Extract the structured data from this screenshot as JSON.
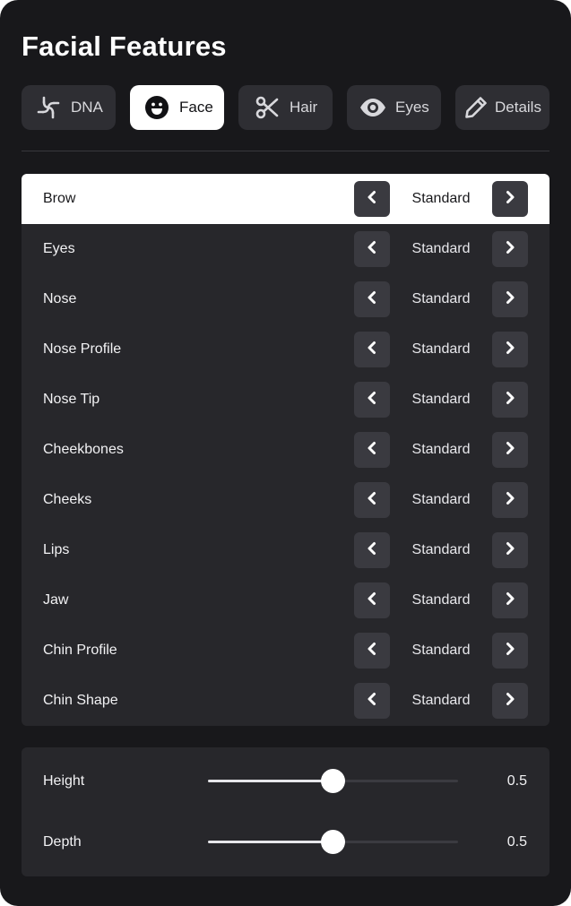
{
  "title": "Facial Features",
  "tabs": [
    {
      "label": "DNA",
      "icon": "dna-icon",
      "active": false
    },
    {
      "label": "Face",
      "icon": "face-smile-icon",
      "active": true
    },
    {
      "label": "Hair",
      "icon": "scissors-icon",
      "active": false
    },
    {
      "label": "Eyes",
      "icon": "eye-icon",
      "active": false
    },
    {
      "label": "Details",
      "icon": "pencil-icon",
      "active": false
    }
  ],
  "features": [
    {
      "label": "Brow",
      "value": "Standard",
      "selected": true
    },
    {
      "label": "Eyes",
      "value": "Standard",
      "selected": false
    },
    {
      "label": "Nose",
      "value": "Standard",
      "selected": false
    },
    {
      "label": "Nose Profile",
      "value": "Standard",
      "selected": false
    },
    {
      "label": "Nose Tip",
      "value": "Standard",
      "selected": false
    },
    {
      "label": "Cheekbones",
      "value": "Standard",
      "selected": false
    },
    {
      "label": "Cheeks",
      "value": "Standard",
      "selected": false
    },
    {
      "label": "Lips",
      "value": "Standard",
      "selected": false
    },
    {
      "label": "Jaw",
      "value": "Standard",
      "selected": false
    },
    {
      "label": "Chin Profile",
      "value": "Standard",
      "selected": false
    },
    {
      "label": "Chin Shape",
      "value": "Standard",
      "selected": false
    }
  ],
  "sliders": [
    {
      "label": "Height",
      "value": "0.5",
      "level": 0.5
    },
    {
      "label": "Depth",
      "value": "0.5",
      "level": 0.5
    }
  ],
  "colors": {
    "panel_bg": "#18181b",
    "list_bg": "#27272b",
    "button_bg": "#3a3a40",
    "selected_bg": "#ffffff",
    "text": "#f2f2f4"
  }
}
